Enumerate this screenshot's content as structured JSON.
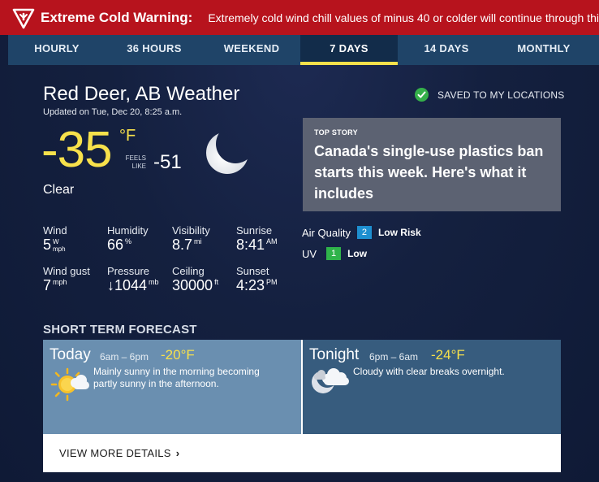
{
  "alert": {
    "title": "Extreme Cold Warning:",
    "text": "Extremely cold wind chill values of minus 40 or colder will continue through this week.",
    "color": "#b7131d"
  },
  "tabs": [
    {
      "label": "HOURLY"
    },
    {
      "label": "36 HOURS"
    },
    {
      "label": "WEEKEND"
    },
    {
      "label": "7 DAYS",
      "active": true
    },
    {
      "label": "14 DAYS"
    },
    {
      "label": "MONTHLY"
    }
  ],
  "location": {
    "title": "Red Deer, AB Weather",
    "updated": "Updated on Tue, Dec 20, 8:25 a.m.",
    "saved_label": "SAVED TO MY LOCATIONS"
  },
  "current": {
    "temp": "-35",
    "unit": "°F",
    "feels_label_1": "FEELS",
    "feels_label_2": "LIKE",
    "feels_value": "-51",
    "condition": "Clear",
    "icon": "moon-icon"
  },
  "top_story": {
    "tag": "TOP STORY",
    "headline": "Canada's single-use plastics ban starts this week. Here's what it includes"
  },
  "metrics": {
    "wind": {
      "label": "Wind",
      "value": "5",
      "unit_top": "W",
      "unit_bottom": "mph"
    },
    "humidity": {
      "label": "Humidity",
      "value": "66",
      "unit": "%"
    },
    "visibility": {
      "label": "Visibility",
      "value": "8.7",
      "unit": "mi"
    },
    "sunrise": {
      "label": "Sunrise",
      "value": "8:41",
      "unit": "AM"
    },
    "wind_gust": {
      "label": "Wind gust",
      "value": "7",
      "unit": "mph"
    },
    "pressure": {
      "label": "Pressure",
      "value": "↓1044",
      "unit": "mb"
    },
    "ceiling": {
      "label": "Ceiling",
      "value": "30000",
      "unit": "ft"
    },
    "sunset": {
      "label": "Sunset",
      "value": "4:23",
      "unit": "PM"
    }
  },
  "air_quality": {
    "label": "Air Quality",
    "value": "2",
    "risk": "Low Risk",
    "color": "#1e8fd0"
  },
  "uv": {
    "label": "UV",
    "value": "1",
    "risk": "Low",
    "color": "#2fb34a"
  },
  "short_term": {
    "title": "SHORT TERM FORECAST",
    "today": {
      "title": "Today",
      "time": "6am – 6pm",
      "temp": "-20°F",
      "desc_1": "Mainly sunny in the morning becoming",
      "desc_2": "partly sunny in the afternoon.",
      "icon": "partly-sunny-icon"
    },
    "tonight": {
      "title": "Tonight",
      "time": "6pm – 6am",
      "temp": "-24°F",
      "desc_1": "Cloudy with clear breaks overnight.",
      "icon": "cloudy-night-icon"
    },
    "more_label": "VIEW MORE DETAILS"
  }
}
